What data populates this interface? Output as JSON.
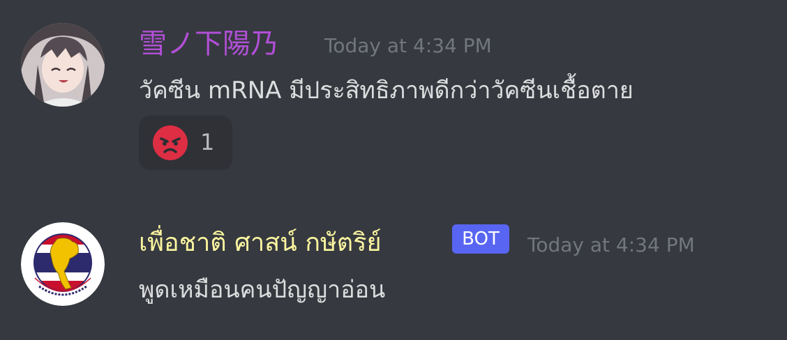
{
  "messages": [
    {
      "username": "雪ノ下陽乃",
      "username_color": "#b04fd6",
      "timestamp": "Today at 4:34 PM",
      "content": "วัคซีน mRNA มีประสิทธิภาพดีกว่าวัคซีนเชื้อตาย",
      "reactions": [
        {
          "emoji": "angry-face-icon",
          "count": "1"
        }
      ]
    },
    {
      "username": "เพื่อชาติ ศาสน์ กษัตริย์",
      "username_color": "#fbf5a0",
      "bot_tag": "BOT",
      "timestamp": "Today at 4:34 PM",
      "content": "พูดเหมือนคนปัญญาอ่อน"
    }
  ],
  "colors": {
    "background": "#36393f",
    "reaction_bg": "#2f3136",
    "bot_tag_bg": "#5865f2",
    "timestamp": "#72767d",
    "text": "#dcddde"
  }
}
